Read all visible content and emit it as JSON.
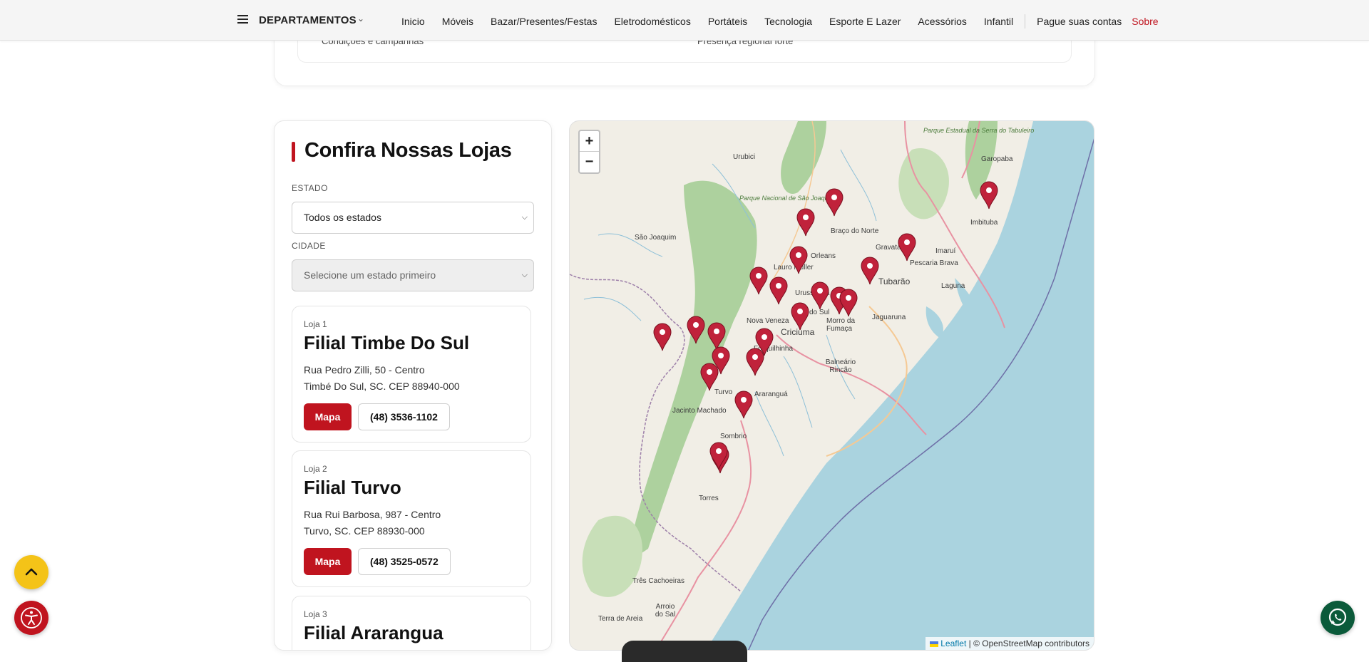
{
  "nav": {
    "departments_label": "DEPARTAMENTOS",
    "links": [
      "Inicio",
      "Móveis",
      "Bazar/Presentes/Festas",
      "Eletrodomésticos",
      "Portáteis",
      "Tecnologia",
      "Esporte E Lazer",
      "Acessórios",
      "Infantil"
    ],
    "bills_label": "Pague suas contas",
    "about_label": "Sobre",
    "about_color": "#c0141f"
  },
  "top_card": {
    "left_text": "Condições e campanhas",
    "right_text": "Presença regional forte"
  },
  "stores_panel": {
    "title": "Confira Nossas Lojas",
    "state_label": "ESTADO",
    "state_value": "Todos os estados",
    "city_label": "CIDADE",
    "city_value": "Selecione um estado primeiro",
    "stores": [
      {
        "number": "Loja 1",
        "name": "Filial Timbe Do Sul",
        "address1": "Rua Pedro Zilli, 50 - Centro",
        "address2": "Timbé Do Sul, SC. CEP 88940-000",
        "map_label": "Mapa",
        "phone": "(48) 3536-1102"
      },
      {
        "number": "Loja 2",
        "name": "Filial Turvo",
        "address1": "Rua Rui Barbosa, 987 - Centro",
        "address2": "Turvo, SC. CEP 88930-000",
        "map_label": "Mapa",
        "phone": "(48) 3525-0572"
      },
      {
        "number": "Loja 3",
        "name": "Filial Ararangua"
      }
    ]
  },
  "map": {
    "zoom_in": "+",
    "zoom_out": "−",
    "attribution_leaflet": "Leaflet",
    "attribution_rest": "| © OpenStreetMap contributors",
    "labels": {
      "urubici": "Urubici",
      "sao_joaquim": "São Joaquim",
      "parque_sj": "Parque Nacional de São Joaquim",
      "parque_serra": "Parque Estadual da Serra do Tabuleiro",
      "garopaba": "Garopaba",
      "imbituba": "Imbituba",
      "braco_norte": "Braço do Norte",
      "orleans": "Orleans",
      "gravatal": "Gravatal",
      "imarui": "Imaruí",
      "lauro_muller": "Lauro Müller",
      "pescaria_brava": "Pescaria Brava",
      "tubarao": "Tubarão",
      "laguna": "Laguna",
      "urussanga": "Urussanga",
      "nova_veneza": "Nova Veneza",
      "do_sul": "do Sul",
      "morro_fumaca": "Morro da Fumaça",
      "criciuma": "Criciúma",
      "jaguaruna": "Jaguaruna",
      "forquilhinha": "Forquilhinha",
      "balneario_rincao": "Balneário Rincão",
      "turvo": "Turvo",
      "ararangua": "Araranguá",
      "jacinto_machado": "Jacinto Machado",
      "sombrio": "Sombrio",
      "torres": "Torres",
      "tres_cachoeiras": "Três Cachoeiras",
      "terra_areia": "Terra de Areia",
      "arroio_sal": "Arroio do Sal"
    },
    "marker_color": "#c0223b"
  }
}
